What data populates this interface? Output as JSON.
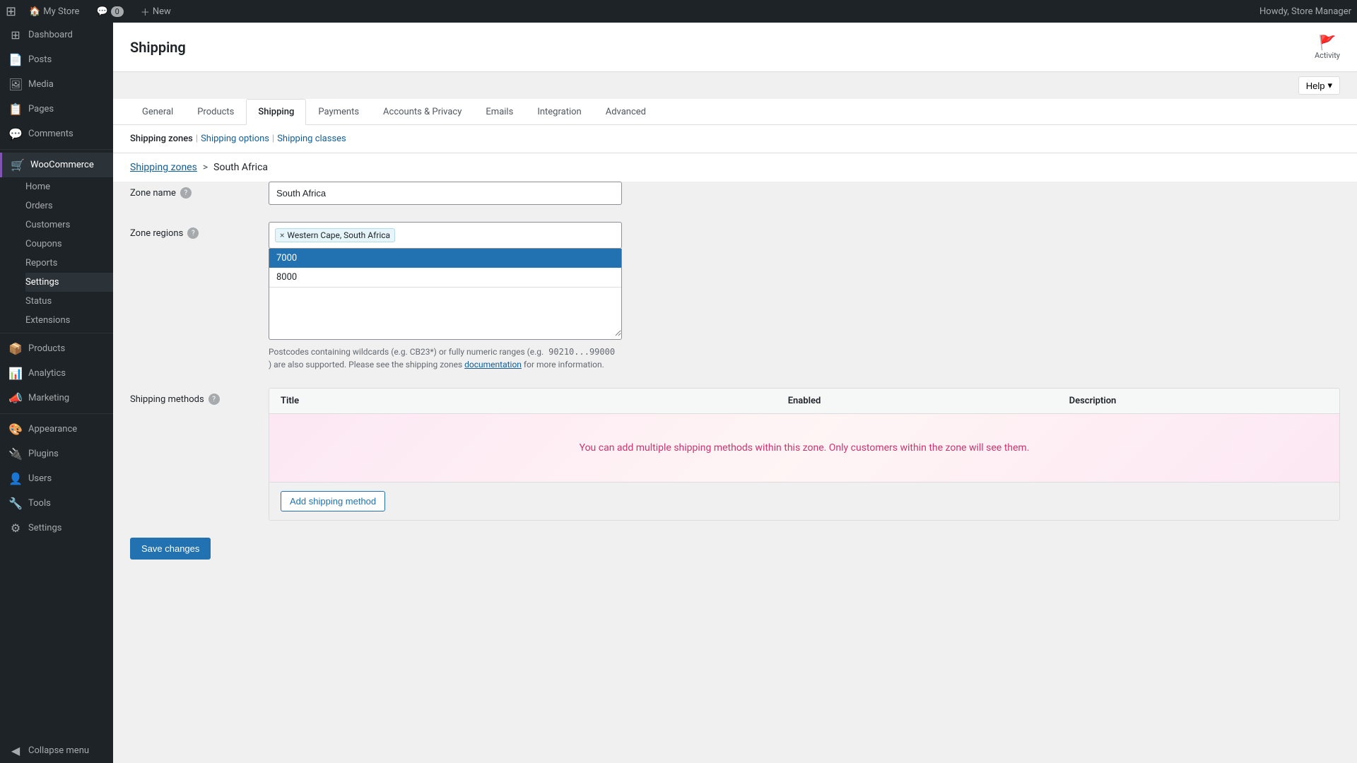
{
  "topbar": {
    "store_name": "My Store",
    "new_label": "New",
    "comments_count": "0",
    "howdy": "Howdy, Store Manager"
  },
  "sidebar": {
    "items": [
      {
        "id": "dashboard",
        "label": "Dashboard",
        "icon": "⊞"
      },
      {
        "id": "posts",
        "label": "Posts",
        "icon": "📄"
      },
      {
        "id": "media",
        "label": "Media",
        "icon": "🖼"
      },
      {
        "id": "pages",
        "label": "Pages",
        "icon": "📋"
      },
      {
        "id": "comments",
        "label": "Comments",
        "icon": "💬"
      },
      {
        "id": "woocommerce",
        "label": "WooCommerce",
        "icon": "🛒",
        "active": true
      },
      {
        "id": "home",
        "label": "Home",
        "sub": true
      },
      {
        "id": "orders",
        "label": "Orders",
        "sub": true
      },
      {
        "id": "customers",
        "label": "Customers",
        "sub": true
      },
      {
        "id": "coupons",
        "label": "Coupons",
        "sub": true
      },
      {
        "id": "reports",
        "label": "Reports",
        "sub": true
      },
      {
        "id": "settings",
        "label": "Settings",
        "sub": true,
        "active": true
      },
      {
        "id": "status",
        "label": "Status",
        "sub": true
      },
      {
        "id": "extensions",
        "label": "Extensions",
        "sub": true
      },
      {
        "id": "products",
        "label": "Products",
        "icon": "📦"
      },
      {
        "id": "analytics",
        "label": "Analytics",
        "icon": "📊"
      },
      {
        "id": "marketing",
        "label": "Marketing",
        "icon": "📣"
      },
      {
        "id": "appearance",
        "label": "Appearance",
        "icon": "🎨"
      },
      {
        "id": "plugins",
        "label": "Plugins",
        "icon": "🔌"
      },
      {
        "id": "users",
        "label": "Users",
        "icon": "👤"
      },
      {
        "id": "tools",
        "label": "Tools",
        "icon": "🔧"
      },
      {
        "id": "settings-main",
        "label": "Settings",
        "icon": "⚙"
      },
      {
        "id": "collapse",
        "label": "Collapse menu",
        "icon": "◀"
      }
    ]
  },
  "header": {
    "title": "Shipping",
    "activity_label": "Activity",
    "help_label": "Help"
  },
  "tabs": [
    {
      "id": "general",
      "label": "General",
      "active": false
    },
    {
      "id": "products",
      "label": "Products",
      "active": false
    },
    {
      "id": "shipping",
      "label": "Shipping",
      "active": true
    },
    {
      "id": "payments",
      "label": "Payments",
      "active": false
    },
    {
      "id": "accounts-privacy",
      "label": "Accounts & Privacy",
      "active": false
    },
    {
      "id": "emails",
      "label": "Emails",
      "active": false
    },
    {
      "id": "integration",
      "label": "Integration",
      "active": false
    },
    {
      "id": "advanced",
      "label": "Advanced",
      "active": false
    }
  ],
  "subnav": [
    {
      "id": "shipping-zones",
      "label": "Shipping zones",
      "current": true
    },
    {
      "id": "shipping-options",
      "label": "Shipping options",
      "current": false
    },
    {
      "id": "shipping-classes",
      "label": "Shipping classes",
      "current": false
    }
  ],
  "breadcrumb": {
    "link_label": "Shipping zones",
    "separator": ">",
    "current": "South Africa"
  },
  "form": {
    "zone_name_label": "Zone name",
    "zone_name_value": "South Africa",
    "zone_regions_label": "Zone regions",
    "zone_regions_tag": "Western Cape, South Africa",
    "postcodes": [
      "7000",
      "8000"
    ],
    "postcode_7000": "7000",
    "postcode_8000": "8000",
    "postcode_help": "Postcodes containing wildcards (e.g. CB23*) or fully numeric ranges (e.g.",
    "postcode_example": "90210...99000",
    "postcode_help2": ") are also supported. Please see the shipping zones",
    "postcode_doc_link": "documentation",
    "postcode_help3": "for more information.",
    "shipping_methods_label": "Shipping methods",
    "table_headers": {
      "title": "Title",
      "enabled": "Enabled",
      "description": "Description"
    },
    "empty_message": "You can add multiple shipping methods within this zone. Only customers within the zone will see them.",
    "add_method_label": "Add shipping method",
    "save_label": "Save changes"
  }
}
